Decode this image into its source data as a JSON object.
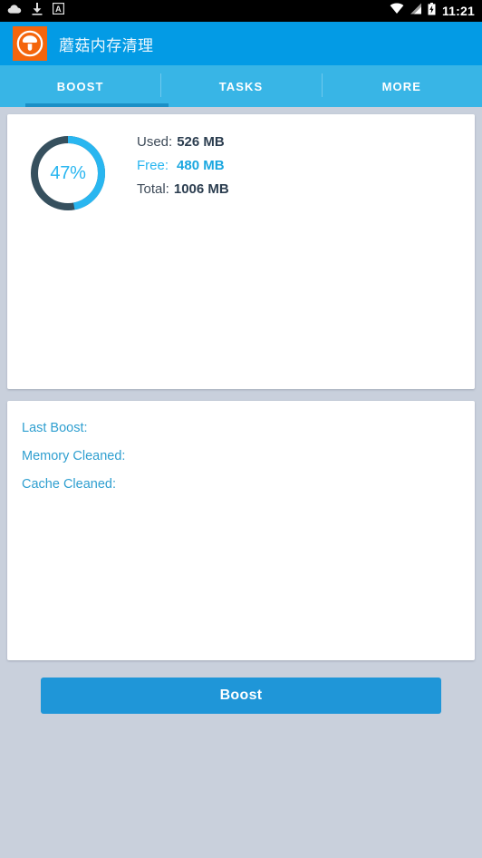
{
  "status_bar": {
    "icons_left": [
      "cloud-icon",
      "download-icon",
      "keyboard-a-icon"
    ],
    "icons_right": [
      "wifi-icon",
      "signal-icon",
      "battery-charging-icon"
    ],
    "time": "11:21"
  },
  "app_bar": {
    "icon": "mushroom-app-icon",
    "title": "蘑菇内存清理"
  },
  "tabs": [
    {
      "label": "BOOST",
      "selected": true
    },
    {
      "label": "TASKS",
      "selected": false
    },
    {
      "label": "MORE",
      "selected": false
    }
  ],
  "memory_card": {
    "percent_label": "47%",
    "percent_value": 47,
    "rows": [
      {
        "label": "Used:",
        "value": "526 MB"
      },
      {
        "label": "Free:",
        "value": "480 MB"
      },
      {
        "label": "Total:",
        "value": "1006 MB"
      }
    ]
  },
  "stats_card": {
    "rows": [
      {
        "label": "Last Boost:",
        "value": ""
      },
      {
        "label": "Memory Cleaned:",
        "value": ""
      },
      {
        "label": "Cache Cleaned:",
        "value": ""
      }
    ]
  },
  "boost_button": {
    "label": "Boost"
  },
  "colors": {
    "accent_blue": "#29b6f0",
    "app_bar_blue": "#039be5",
    "tab_blue": "#38b5e6",
    "tab_indicator": "#1a8fc6",
    "button_blue": "#1f96d8",
    "donut_track": "#36505e",
    "background": "#c9d0dc",
    "icon_orange": "#f4650c"
  }
}
